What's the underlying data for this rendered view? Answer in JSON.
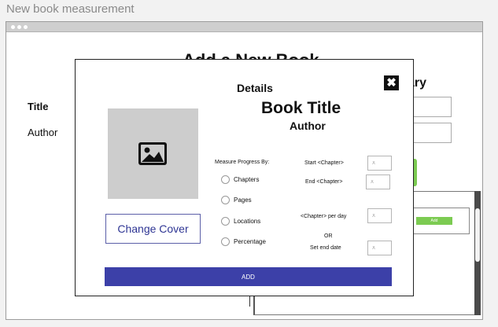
{
  "page": {
    "title": "New book measurement"
  },
  "background": {
    "heading": "Add a New Book",
    "title_label": "Title",
    "author_label": "Author",
    "ary_text": "ary",
    "panel_button": "Add"
  },
  "modal": {
    "heading": "Details",
    "close_symbol": "✖",
    "book_title": "Book Title",
    "author": "Author",
    "change_cover_label": "Change Cover",
    "measure_label": "Measure Progress By:",
    "options": [
      {
        "label": "Chapters"
      },
      {
        "label": "Pages"
      },
      {
        "label": "Locations"
      },
      {
        "label": "Percentage"
      }
    ],
    "start_label": "Start <Chapter>",
    "end_label": "End  <Chapter>",
    "per_day_label": "<Chapter> per day",
    "or_label": "OR",
    "end_date_label": "Set end date",
    "input_placeholder": "X",
    "add_label": "ADD"
  },
  "colors": {
    "primary_button": "#3c40a8",
    "accent_green": "#7ccb52",
    "cover_placeholder": "#cdcdcd"
  },
  "icons": {
    "cover": "image-icon",
    "close": "close-icon"
  }
}
